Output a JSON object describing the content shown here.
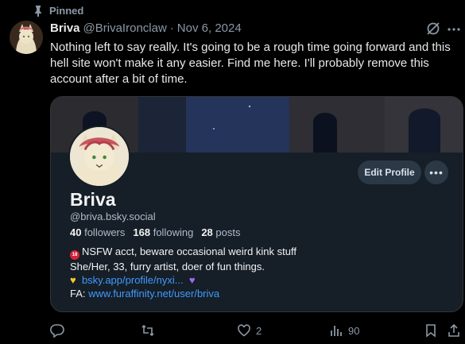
{
  "pinned": {
    "label": "Pinned"
  },
  "tweet": {
    "author_name": "Briva",
    "author_handle": "@BrivaIronclaw",
    "dot": "·",
    "date": "Nov 6, 2024",
    "text": "Nothing left to say really. It's going to be a rough time going forward and this hell site won't make it any easier. Find me here. I'll probably remove this account after a bit of time."
  },
  "card": {
    "display_name": "Briva",
    "handle": "@briva.bsky.social",
    "edit_profile_label": "Edit Profile",
    "more_label": "•••",
    "stats": {
      "followers_count": "40",
      "followers_label": "followers",
      "following_count": "168",
      "following_label": "following",
      "posts_count": "28",
      "posts_label": "posts"
    },
    "bio": {
      "nsfw_badge": "18",
      "line1": "NSFW acct, beware occasional weird kink stuff",
      "line2": "She/Her, 33, furry artist, doer of fun things.",
      "link1": "bsky.app/profile/nyxi...",
      "fa_label": "FA:",
      "link2": "www.furaffinity.net/user/briva"
    }
  },
  "actions": {
    "reply_count": "",
    "retweet_count": "",
    "like_count": "2",
    "views_count": "90"
  },
  "colors": {
    "background": "#000000",
    "text": "#e7e9ea",
    "muted": "#8b98a5",
    "card_bg": "#161e27",
    "link": "#3f9bff"
  }
}
